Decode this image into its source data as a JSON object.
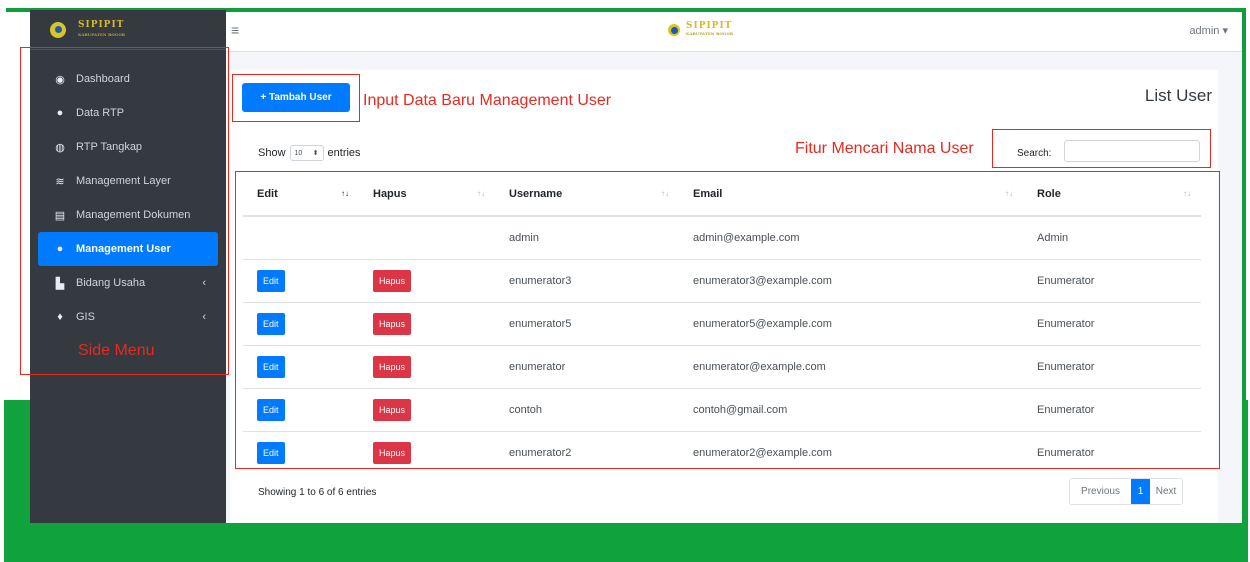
{
  "colors": {
    "green": "#10a33d",
    "sidebar": "#343a40",
    "primary": "#007bff",
    "danger": "#dc3545",
    "annotation": "#e32b22"
  },
  "brand": {
    "name": "SIPIPIT",
    "subtitle": "KABUPATEN BOGOR"
  },
  "sidebar": {
    "items": [
      {
        "label": "Dashboard",
        "icon": "dashboard-icon"
      },
      {
        "label": "Data RTP",
        "icon": "user-icon"
      },
      {
        "label": "RTP Tangkap",
        "icon": "globe-icon"
      },
      {
        "label": "Management Layer",
        "icon": "layers-icon"
      },
      {
        "label": "Management Dokumen",
        "icon": "document-icon"
      },
      {
        "label": "Management User",
        "icon": "user-icon",
        "active": true
      },
      {
        "label": "Bidang Usaha",
        "icon": "chart-icon"
      },
      {
        "label": "GIS",
        "icon": "map-marker-icon"
      }
    ]
  },
  "topbar": {
    "user": "admin"
  },
  "main": {
    "add_button": "Tambah User",
    "title": "List User",
    "show_label": "Show",
    "entries_value": "10",
    "entries_label": "entries",
    "search_label": "Search:",
    "search_value": "",
    "columns": [
      "Edit",
      "Hapus",
      "Username",
      "Email",
      "Role"
    ],
    "rows": [
      {
        "username": "admin",
        "email": "admin@example.com",
        "role": "Admin",
        "actions": false
      },
      {
        "username": "enumerator3",
        "email": "enumerator3@example.com",
        "role": "Enumerator",
        "actions": true
      },
      {
        "username": "enumerator5",
        "email": "enumerator5@example.com",
        "role": "Enumerator",
        "actions": true
      },
      {
        "username": "enumerator",
        "email": "enumerator@example.com",
        "role": "Enumerator",
        "actions": true
      },
      {
        "username": "contoh",
        "email": "contoh@gmail.com",
        "role": "Enumerator",
        "actions": true
      },
      {
        "username": "enumerator2",
        "email": "enumerator2@example.com",
        "role": "Enumerator",
        "actions": true
      }
    ],
    "edit_label": "Edit",
    "hapus_label": "Hapus",
    "info": "Showing 1 to 6 of 6 entries",
    "pagination": {
      "previous": "Previous",
      "current": "1",
      "next": "Next"
    }
  },
  "annotations": {
    "add": "Input Data Baru Management User",
    "search": "Fitur Mencari Nama User",
    "menu": "Side Menu"
  }
}
